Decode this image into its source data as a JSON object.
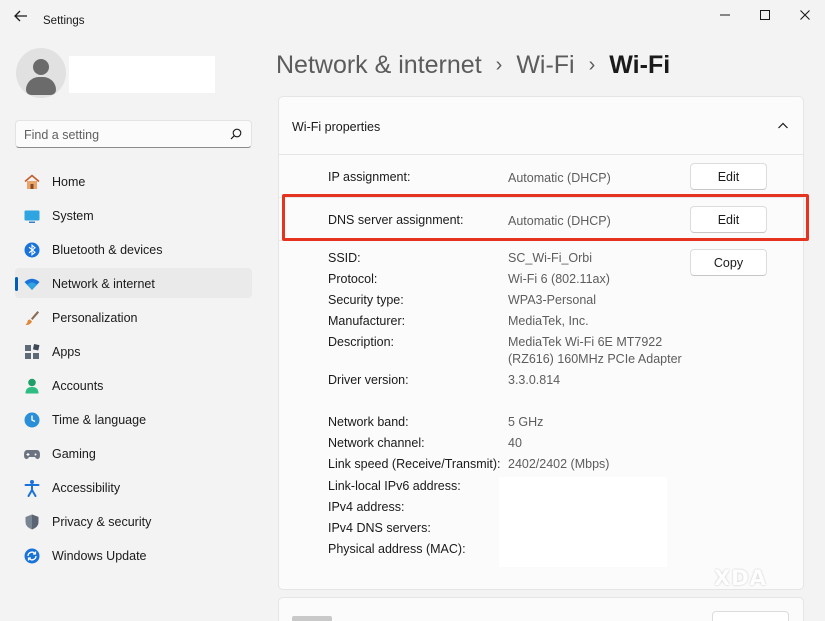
{
  "window": {
    "app_title": "Settings"
  },
  "sidebar": {
    "search_placeholder": "Find a setting",
    "items": [
      {
        "label": "Home",
        "icon": "home-icon",
        "active": false
      },
      {
        "label": "System",
        "icon": "system-icon",
        "active": false
      },
      {
        "label": "Bluetooth & devices",
        "icon": "bluetooth-icon",
        "active": false
      },
      {
        "label": "Network & internet",
        "icon": "wifi-icon",
        "active": true
      },
      {
        "label": "Personalization",
        "icon": "brush-icon",
        "active": false
      },
      {
        "label": "Apps",
        "icon": "apps-icon",
        "active": false
      },
      {
        "label": "Accounts",
        "icon": "account-icon",
        "active": false
      },
      {
        "label": "Time & language",
        "icon": "clock-globe-icon",
        "active": false
      },
      {
        "label": "Gaming",
        "icon": "gamepad-icon",
        "active": false
      },
      {
        "label": "Accessibility",
        "icon": "accessibility-icon",
        "active": false
      },
      {
        "label": "Privacy & security",
        "icon": "shield-icon",
        "active": false
      },
      {
        "label": "Windows Update",
        "icon": "update-icon",
        "active": false
      }
    ]
  },
  "breadcrumb": {
    "items": [
      "Network & internet",
      "Wi-Fi"
    ],
    "current": "Wi-Fi"
  },
  "card": {
    "title": "Wi-Fi properties",
    "ip_assignment": {
      "label": "IP assignment:",
      "value": "Automatic (DHCP)",
      "button": "Edit"
    },
    "dns_assignment": {
      "label": "DNS server assignment:",
      "value": "Automatic (DHCP)",
      "button": "Edit"
    },
    "copy_button": "Copy",
    "properties": [
      {
        "label": "SSID:",
        "value": "SC_Wi-Fi_Orbi"
      },
      {
        "label": "Protocol:",
        "value": "Wi-Fi 6 (802.11ax)"
      },
      {
        "label": "Security type:",
        "value": "WPA3-Personal"
      },
      {
        "label": "Manufacturer:",
        "value": "MediaTek, Inc."
      },
      {
        "label": "Description:",
        "value": "MediaTek Wi-Fi 6E MT7922",
        "value2": "(RZ616) 160MHz PCIe Adapter"
      },
      {
        "label": "Driver version:",
        "value": "3.3.0.814"
      },
      {
        "label": "Network band:",
        "value": "5 GHz"
      },
      {
        "label": "Network channel:",
        "value": "40"
      },
      {
        "label": "Link speed (Receive/Transmit):",
        "value": "2402/2402 (Mbps)"
      },
      {
        "label": "Link-local IPv6 address:",
        "value": ""
      },
      {
        "label": "IPv4 address:",
        "value": ""
      },
      {
        "label": "IPv4 DNS servers:",
        "value": ""
      },
      {
        "label": "Physical address (MAC):",
        "value": ""
      }
    ]
  },
  "watermark": "XDA",
  "colors": {
    "accent": "#005fb8",
    "highlight": "#e5331f",
    "background": "#f3f3f3"
  }
}
